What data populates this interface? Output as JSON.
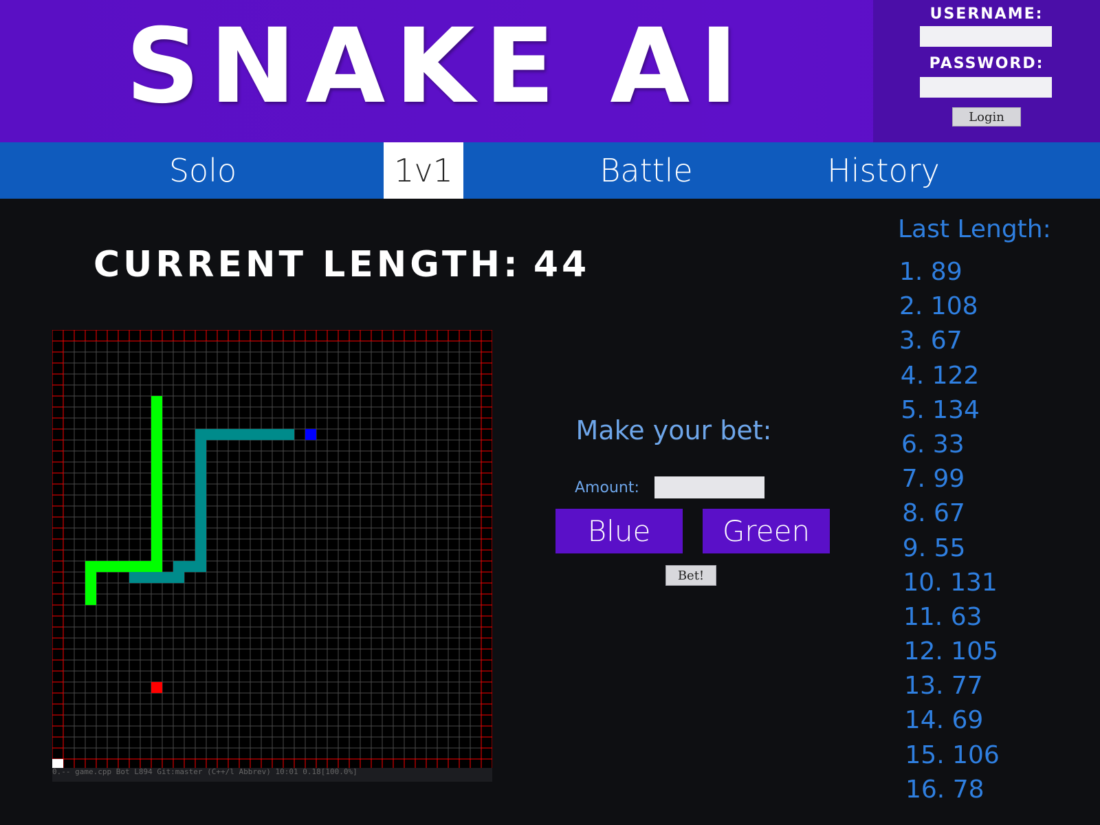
{
  "header": {
    "title": "SNAKE AI",
    "login": {
      "username_label": "USERNAME:",
      "password_label": "PASSWORD:",
      "username_value": "",
      "password_value": "",
      "button_label": "Login"
    }
  },
  "nav": {
    "tabs": [
      {
        "label": "Solo",
        "active": false
      },
      {
        "label": "1v1",
        "active": true
      },
      {
        "label": "Battle",
        "active": false
      },
      {
        "label": "History",
        "active": false
      }
    ]
  },
  "game": {
    "current_length_label": "CURRENT LENGTH:",
    "current_length_value": "44",
    "board": {
      "cols": 40,
      "rows": 40,
      "border_color": "#ff0000",
      "grid_color": "#4a4a4a",
      "background": "#000000",
      "snakes": [
        {
          "color": "#00ff00",
          "cells": [
            [
              9,
              6
            ],
            [
              9,
              7
            ],
            [
              9,
              8
            ],
            [
              9,
              9
            ],
            [
              9,
              10
            ],
            [
              9,
              11
            ],
            [
              9,
              12
            ],
            [
              9,
              13
            ],
            [
              9,
              14
            ],
            [
              9,
              15
            ],
            [
              9,
              16
            ],
            [
              9,
              17
            ],
            [
              9,
              18
            ],
            [
              9,
              19
            ],
            [
              9,
              20
            ],
            [
              9,
              21
            ],
            [
              8,
              21
            ],
            [
              7,
              21
            ],
            [
              6,
              21
            ],
            [
              5,
              21
            ],
            [
              4,
              21
            ],
            [
              3,
              21
            ],
            [
              3,
              22
            ],
            [
              3,
              23
            ],
            [
              3,
              24
            ]
          ]
        },
        {
          "color": "#008b8b",
          "cells": [
            [
              21,
              9
            ],
            [
              20,
              9
            ],
            [
              19,
              9
            ],
            [
              18,
              9
            ],
            [
              17,
              9
            ],
            [
              16,
              9
            ],
            [
              15,
              9
            ],
            [
              14,
              9
            ],
            [
              13,
              9
            ],
            [
              13,
              10
            ],
            [
              13,
              11
            ],
            [
              13,
              12
            ],
            [
              13,
              13
            ],
            [
              13,
              14
            ],
            [
              13,
              15
            ],
            [
              13,
              16
            ],
            [
              13,
              17
            ],
            [
              13,
              18
            ],
            [
              13,
              19
            ],
            [
              13,
              20
            ],
            [
              13,
              21
            ],
            [
              12,
              21
            ],
            [
              11,
              21
            ],
            [
              11,
              22
            ],
            [
              10,
              22
            ],
            [
              9,
              22
            ],
            [
              8,
              22
            ],
            [
              7,
              22
            ]
          ]
        }
      ],
      "foods": [
        {
          "color": "#0000ff",
          "cell": [
            23,
            9
          ]
        },
        {
          "color": "#ff0000",
          "cell": [
            9,
            32
          ]
        },
        {
          "color": "#ffffff",
          "cell": [
            0,
            39
          ]
        }
      ]
    },
    "footer_text": "0.--  game.cpp      Bot L894  Git:master  (C++/l Abbrev)  10:01 0.18[100.0%]"
  },
  "bet": {
    "title": "Make your bet:",
    "amount_label": "Amount:",
    "amount_value": "",
    "choices": [
      "Blue",
      "Green"
    ],
    "button_label": "Bet!"
  },
  "history": {
    "title": "Last Length:",
    "entries": [
      "1. 89",
      "2. 108",
      "3. 67",
      "4. 122",
      "5. 134",
      "6. 33",
      "7. 99",
      "8. 67",
      "9. 55",
      "10. 131",
      "11. 63",
      "12. 105",
      "13. 77",
      "14. 69",
      "15. 106",
      "16. 78"
    ]
  },
  "colors": {
    "header_bg": "#5e10c9",
    "login_bg": "#4b0ea8",
    "nav_bg": "#0f5bbd",
    "page_bg": "#0e0f12",
    "bet_text": "#6ea6ea",
    "history_text": "#2f7fe0",
    "bet_choice_bg": "#5a10c8"
  }
}
